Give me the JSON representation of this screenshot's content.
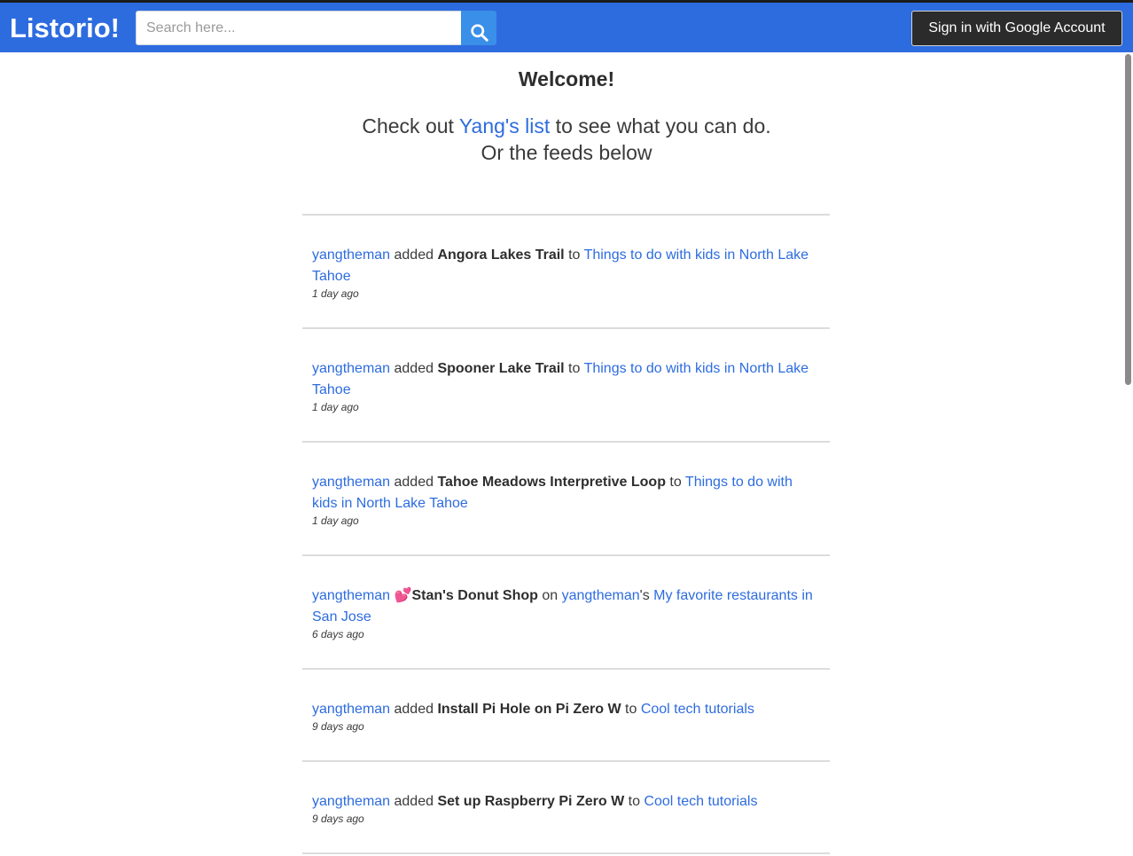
{
  "header": {
    "brand": "Listorio!",
    "search_placeholder": "Search here...",
    "search_icon": "search-icon",
    "signin_label": "Sign in with Google Account"
  },
  "colors": {
    "topbar": "#2d6cdf",
    "link": "#2d6cdf",
    "search_button": "#3a8fe8",
    "signin_button": "#2b2b2b"
  },
  "welcome": {
    "title": "Welcome!",
    "line1_before": "Check out ",
    "line1_link": "Yang's list",
    "line1_after": " to see what you can do.",
    "line2": "Or the feeds below"
  },
  "feed": [
    {
      "user": "yangtheman",
      "action": " added ",
      "item": "Angora Lakes Trail",
      "connector": " to ",
      "list": "Things to do with kids in North Lake Tahoe",
      "time": "1 day ago"
    },
    {
      "user": "yangtheman",
      "action": " added ",
      "item": "Spooner Lake Trail",
      "connector": " to ",
      "list": "Things to do with kids in North Lake Tahoe",
      "time": "1 day ago"
    },
    {
      "user": "yangtheman",
      "action": " added ",
      "item": "Tahoe Meadows Interpretive Loop",
      "connector": " to ",
      "list": "Things to do with kids in North Lake Tahoe",
      "time": "1 day ago"
    },
    {
      "user": "yangtheman",
      "action": " 💕",
      "item": "Stan's Donut Shop",
      "connector": " on ",
      "owner": "yangtheman",
      "owner_suffix": "'s ",
      "list": "My favorite restaurants in San Jose",
      "time": "6 days ago"
    },
    {
      "user": "yangtheman",
      "action": " added ",
      "item": "Install Pi Hole on Pi Zero W",
      "connector": " to ",
      "list": "Cool tech tutorials",
      "time": "9 days ago"
    },
    {
      "user": "yangtheman",
      "action": " added ",
      "item": "Set up Raspberry Pi Zero W",
      "connector": " to ",
      "list": "Cool tech tutorials",
      "time": "9 days ago"
    }
  ]
}
